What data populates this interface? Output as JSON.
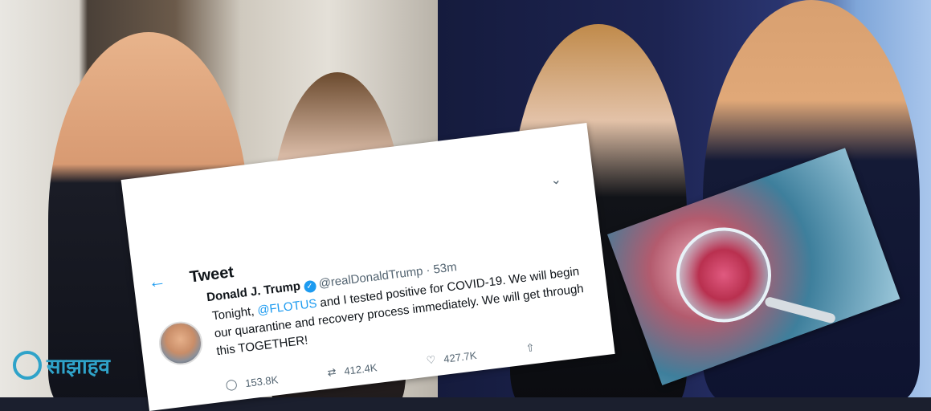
{
  "tweet": {
    "header_title": "Tweet",
    "display_name": "Donald J. Trump",
    "handle_time": "@realDonaldTrump · 53m",
    "text_before": "Tonight, ",
    "mention": "@FLOTUS",
    "text_after": " and I tested positive for COVID-19. We will begin our quarantine and recovery process immediately. We will get through this TOGETHER!",
    "replies": "153.8K",
    "retweets": "412.4K",
    "likes": "427.7K"
  },
  "icons": [
    "back-arrow-icon",
    "verified-badge-icon",
    "chevron-down-icon",
    "reply-icon",
    "retweet-icon",
    "like-icon",
    "share-icon",
    "logo-icon"
  ],
  "colors": {
    "twitter_blue": "#1d9bf0",
    "logo_blue": "#2fa3c9"
  },
  "logo": {
    "text": "साझाहव"
  }
}
